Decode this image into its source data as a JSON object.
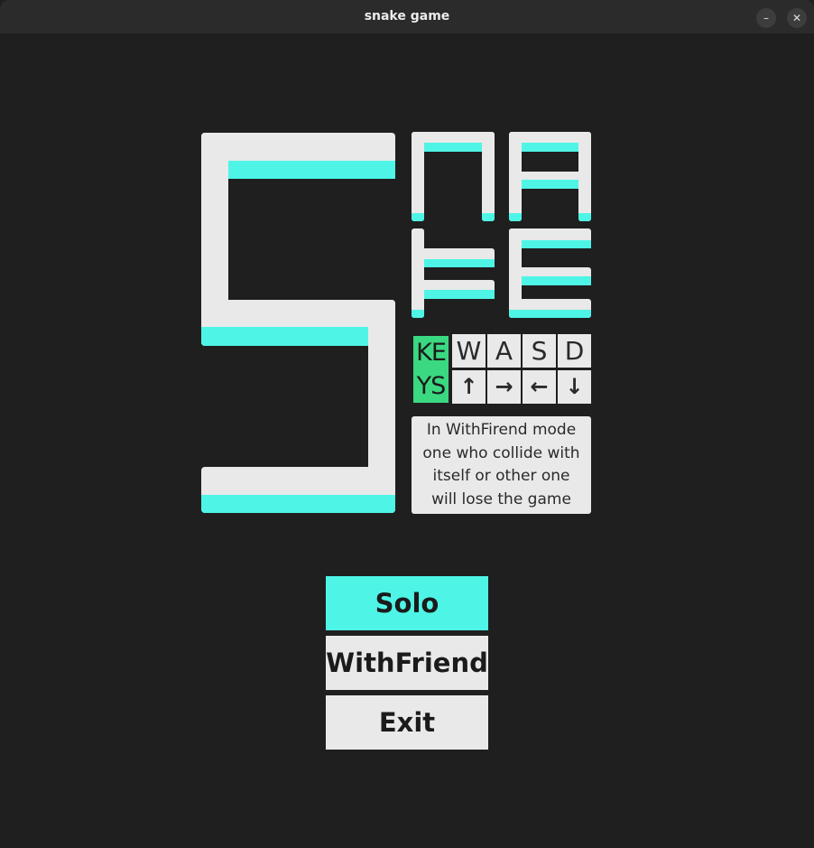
{
  "window": {
    "title": "snake game",
    "minimize_label": "–",
    "close_label": "✕"
  },
  "keys": {
    "label_line1": "KE",
    "label_line2": "YS",
    "player1": [
      "W",
      "A",
      "S",
      "D"
    ],
    "player2": [
      "↑",
      "→",
      "←",
      "↓"
    ]
  },
  "info": {
    "lines": [
      "In WithFirend mode",
      "one who collide with",
      "itself or other one",
      "will lose the game"
    ]
  },
  "menu": {
    "solo_label": "Solo",
    "withfriend_label": "WithFriend",
    "exit_label": "Exit"
  },
  "colors": {
    "background": "#1f1f1f",
    "block_white": "#e9e9e9",
    "accent_cyan": "#4ef5e6",
    "keys_green": "#3ad981"
  }
}
